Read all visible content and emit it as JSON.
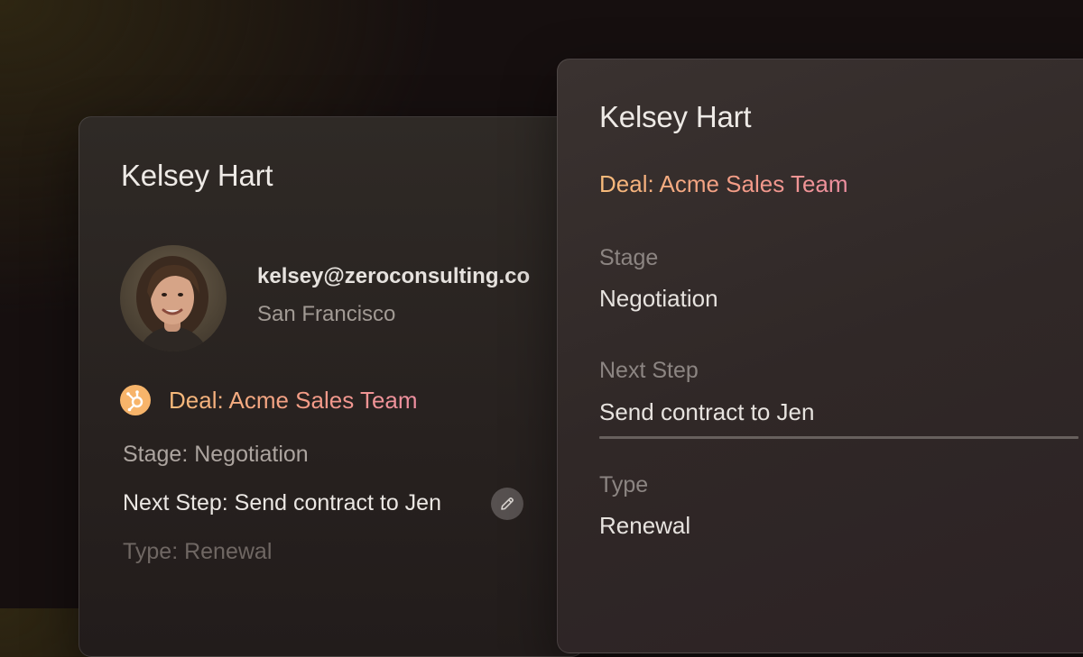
{
  "left_card": {
    "name": "Kelsey Hart",
    "email": "kelsey@zeroconsulting.co",
    "city": "San Francisco",
    "deal": "Deal: Acme Sales Team",
    "stage": "Stage: Negotiation",
    "next_step": "Next Step: Send contract to Jen",
    "type": "Type: Renewal"
  },
  "right_card": {
    "name": "Kelsey Hart",
    "deal": "Deal: Acme Sales Team",
    "fields": [
      {
        "label": "Stage",
        "value": "Negotiation"
      },
      {
        "label": "Next Step",
        "value": "Send contract to Jen"
      },
      {
        "label": "Type",
        "value": "Renewal"
      }
    ]
  },
  "icons": {
    "deal_source": "hubspot-icon",
    "edit": "pencil-icon"
  },
  "colors": {
    "deal_gradient_start": "#f7bb7a",
    "deal_gradient_end": "#ee8fa1",
    "hubspot_orange": "#f7b46a"
  }
}
